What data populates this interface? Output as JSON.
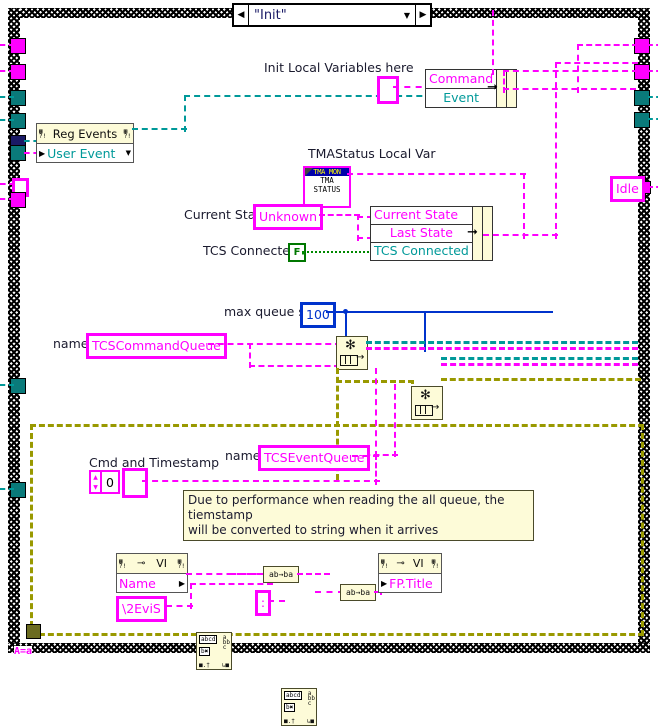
{
  "diagram": {
    "type": "labview-block-diagram",
    "case_selector": {
      "value": "\"Init\"",
      "left_arrow": "◀",
      "right_arrow": "▶",
      "dropdown": "▼"
    }
  },
  "labels": {
    "init_local_vars": "Init Local Variables here",
    "tma_status_local_var": "TMAStatus Local Var",
    "current_state": "Current State",
    "tcs_connected": "TCS Connected",
    "max_queue_size": "max queue size",
    "name_command": "name",
    "name_event": "name",
    "cmd_and_timestamp": "Cmd and Timestamp",
    "bottom_left_marker": "A=a"
  },
  "constants": {
    "unknown": "Unknown",
    "tcs_connected_bool": "F",
    "queue_size": "100",
    "command_queue_name": "TCSCommandQueue",
    "event_queue_name": "TCSEventQueue",
    "idle": "Idle",
    "timestamp_number": "0",
    "vi_extension": "\\2EviS"
  },
  "nodes": {
    "reg_events": {
      "title": "Reg Events",
      "item": "User Event",
      "dropdown": "▼"
    },
    "bundle_command_event": {
      "rows": [
        "Command",
        "Event"
      ]
    },
    "bundle_state": {
      "rows": [
        "Current State",
        "Last State",
        "TCS Connected"
      ]
    },
    "local_var": {
      "line1": "TMA MON",
      "line2": "TMA",
      "line3": "STATUS"
    },
    "property_name": {
      "badge": "VI",
      "label": "Name",
      "arrow": "▶"
    },
    "property_fp_title": {
      "badge": "VI",
      "label": "FP.Title",
      "arrow": "▶"
    },
    "search_replace_1": {
      "glyph_top": "abcd",
      "glyph_bot": "b✖",
      "side": "a bb c"
    },
    "search_replace_2": {
      "glyph_top": "abcd",
      "glyph_bot": "b✖",
      "side": "a bb c"
    },
    "to_lower_1": {
      "label": "ab→ba"
    },
    "to_lower_2": {
      "label": "ab→ba"
    },
    "obtain_queue_1": {
      "name": "obtain-queue"
    },
    "obtain_queue_2": {
      "name": "obtain-queue"
    },
    "colon_constant": ":"
  },
  "comment": {
    "line1": "Due to performance when reading the all queue, the tiemstamp",
    "line2": "will be converted to string when it arrives"
  },
  "colors": {
    "wire_pink": "#ff00ff",
    "wire_teal": "#009999",
    "wire_blue": "#0033cc",
    "wire_green": "#008800",
    "node_fill": "#fdfbd8",
    "comment_fill": "#fdfbd8",
    "structure_border_yellow": "#999900"
  }
}
